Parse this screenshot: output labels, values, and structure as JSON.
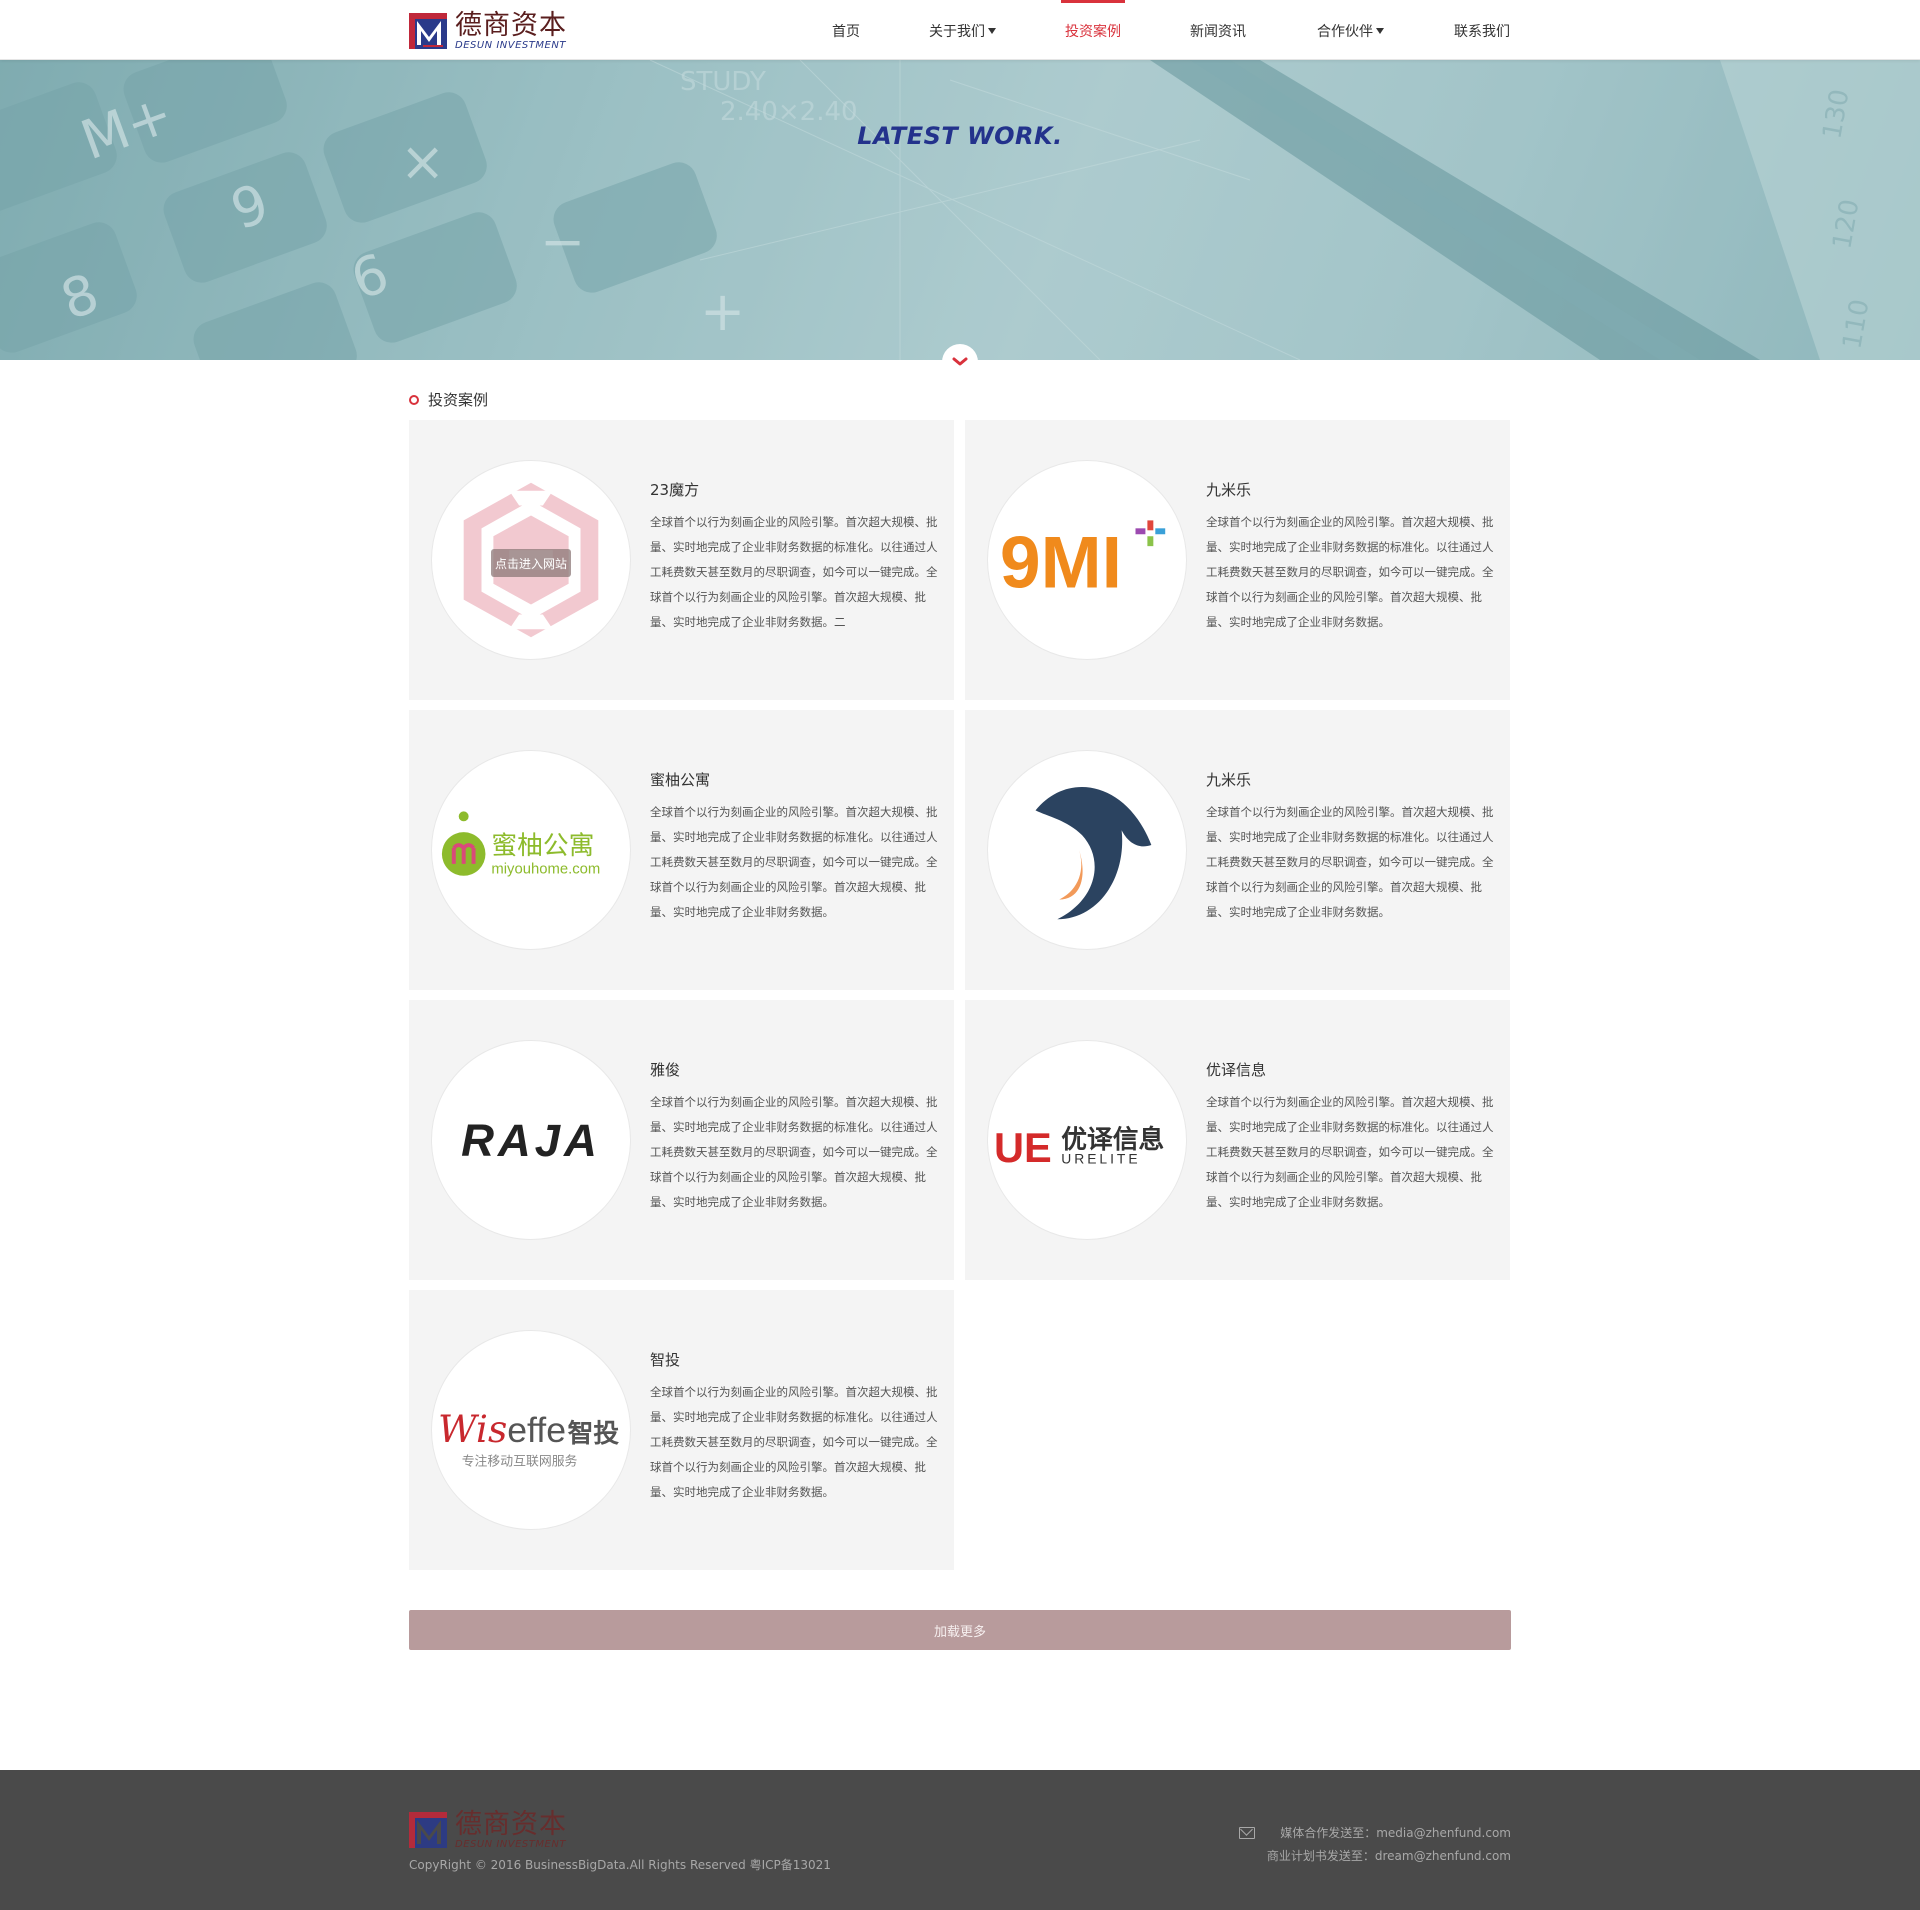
{
  "header": {
    "logo_cn": "德商资本",
    "logo_en": "DESUN INVESTMENT",
    "nav": [
      {
        "label": "首页",
        "has_dropdown": false
      },
      {
        "label": "关于我们",
        "has_dropdown": true
      },
      {
        "label": "投资案例",
        "has_dropdown": false,
        "active": true
      },
      {
        "label": "新闻资讯",
        "has_dropdown": false
      },
      {
        "label": "合作伙伴",
        "has_dropdown": true
      },
      {
        "label": "联系我们",
        "has_dropdown": false
      }
    ]
  },
  "banner": {
    "title": "LATEST WORK.",
    "down_icon": "chevron-down-icon"
  },
  "section": {
    "title": "投资案例"
  },
  "cases": [
    {
      "name": "23魔方",
      "logo": "23mofang-logo",
      "hover_label": "点击进入网站",
      "desc": "全球首个以行为刻画企业的风险引擎。首次超大规模、批量、实时地完成了企业非财务数据的标准化。以往通过人工耗费数天甚至数月的尽职调查，如今可以一键完成。全球首个以行为刻画企业的风险引擎。首次超大规模、批量、实时地完成了企业非财务数据。二"
    },
    {
      "name": "九米乐",
      "logo": "9mi-logo",
      "logo_text": "9MI",
      "desc": "全球首个以行为刻画企业的风险引擎。首次超大规模、批量、实时地完成了企业非财务数据的标准化。以往通过人工耗费数天甚至数月的尽职调查，如今可以一键完成。全球首个以行为刻画企业的风险引擎。首次超大规模、批量、实时地完成了企业非财务数据。"
    },
    {
      "name": "蜜柚公寓",
      "logo": "miyou-logo",
      "logo_text": "蜜柚公寓",
      "logo_sub": "miyouhome.com",
      "desc": "全球首个以行为刻画企业的风险引擎。首次超大规模、批量、实时地完成了企业非财务数据的标准化。以往通过人工耗费数天甚至数月的尽职调查，如今可以一键完成。全球首个以行为刻画企业的风险引擎。首次超大规模、批量、实时地完成了企业非财务数据。"
    },
    {
      "name": "九米乐",
      "logo": "bird-logo",
      "desc": "全球首个以行为刻画企业的风险引擎。首次超大规模、批量、实时地完成了企业非财务数据的标准化。以往通过人工耗费数天甚至数月的尽职调查，如今可以一键完成。全球首个以行为刻画企业的风险引擎。首次超大规模、批量、实时地完成了企业非财务数据。"
    },
    {
      "name": "雅俊",
      "logo": "raja-logo",
      "logo_text": "RAJA",
      "desc": "全球首个以行为刻画企业的风险引擎。首次超大规模、批量、实时地完成了企业非财务数据的标准化。以往通过人工耗费数天甚至数月的尽职调查，如今可以一键完成。全球首个以行为刻画企业的风险引擎。首次超大规模、批量、实时地完成了企业非财务数据。"
    },
    {
      "name": "优译信息",
      "logo": "urelite-logo",
      "logo_text": "优译信息",
      "logo_sub": "URELITE",
      "logo_mark": "UE",
      "desc": "全球首个以行为刻画企业的风险引擎。首次超大规模、批量、实时地完成了企业非财务数据的标准化。以往通过人工耗费数天甚至数月的尽职调查，如今可以一键完成。全球首个以行为刻画企业的风险引擎。首次超大规模、批量、实时地完成了企业非财务数据。"
    },
    {
      "name": "智投",
      "logo": "wiseffe-logo",
      "logo_text_a": "Wis",
      "logo_text_b": "effe",
      "logo_text_c": "智投",
      "logo_sub": "专注移动互联网服务",
      "desc": "全球首个以行为刻画企业的风险引擎。首次超大规模、批量、实时地完成了企业非财务数据的标准化。以往通过人工耗费数天甚至数月的尽职调查，如今可以一键完成。全球首个以行为刻画企业的风险引擎。首次超大规模、批量、实时地完成了企业非财务数据。"
    }
  ],
  "load_more": "加载更多",
  "footer": {
    "logo_cn": "德商资本",
    "logo_en": "DESUN INVESTMENT",
    "copyright": "CopyRight © 2016 BusinessBigData.All Rights Reserved 粤ICP备13021",
    "media_email": "媒体合作发送至：media@zhenfund.com",
    "plan_email": "商业计划书发送至：dream@zhenfund.com",
    "mail_icon": "mail-icon"
  },
  "colors": {
    "accent": "#d9323c",
    "banner_title": "#23328c",
    "load_more_bg": "#b89b9c",
    "footer_bg": "#4a4a4a"
  }
}
